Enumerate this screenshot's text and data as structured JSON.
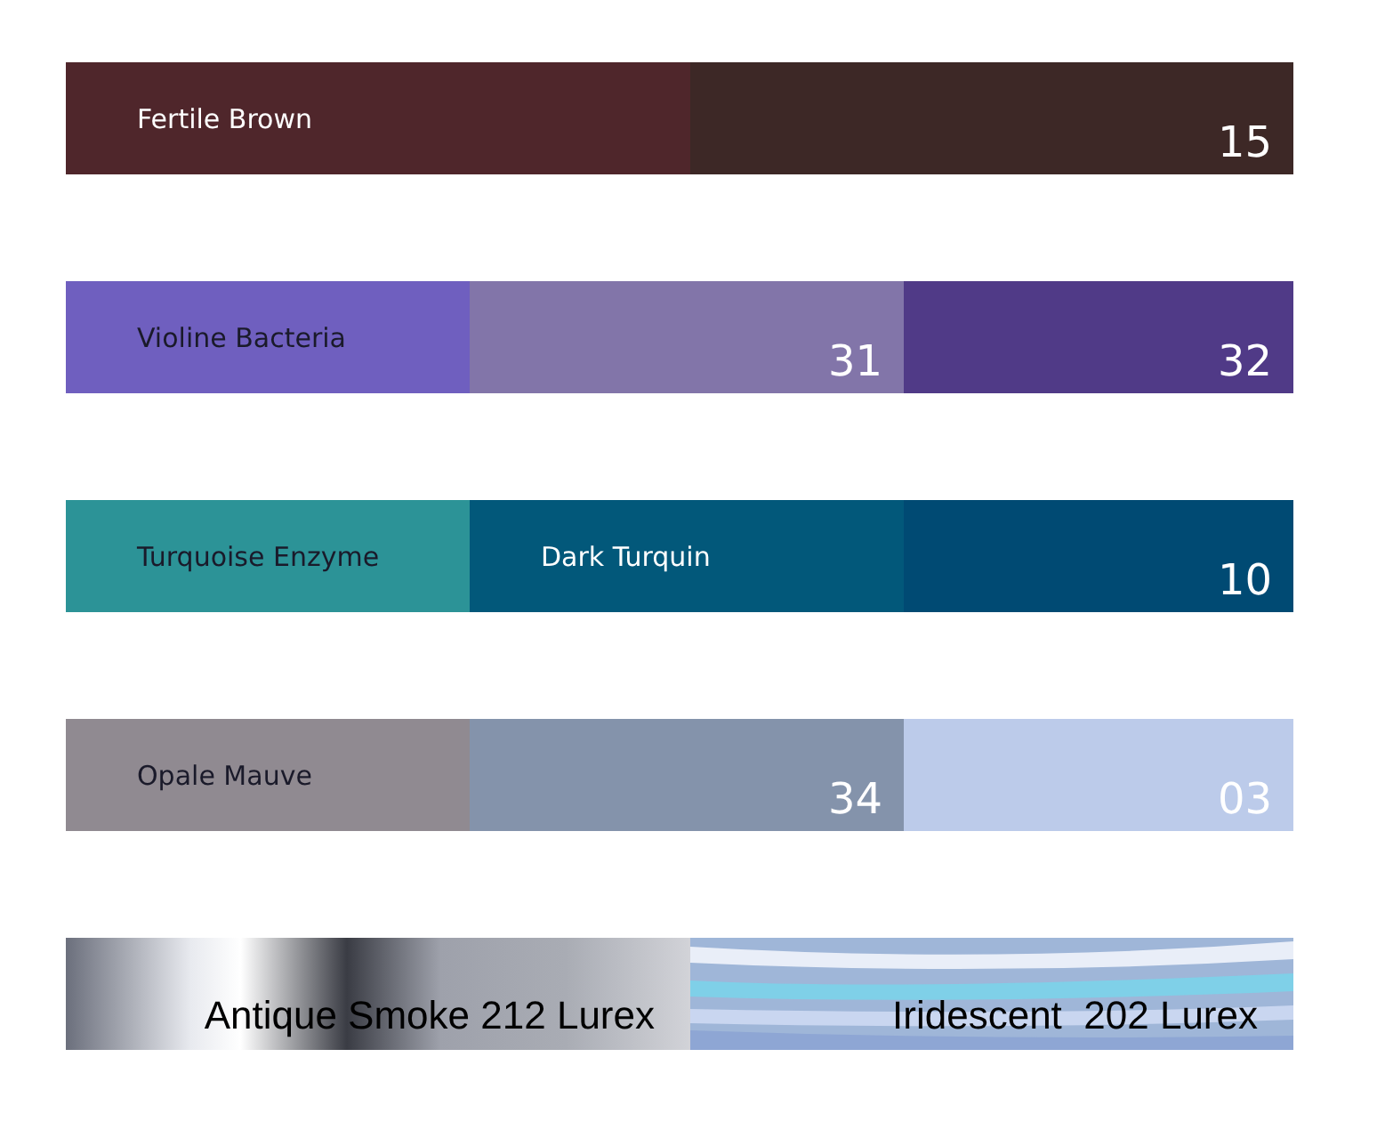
{
  "swatch_rows": [
    {
      "segments": [
        {
          "kind": "label",
          "text": "Fertile Brown",
          "color": "#4f262b"
        },
        {
          "kind": "number",
          "text": "15",
          "color": "#3d2826"
        }
      ]
    },
    {
      "segments": [
        {
          "kind": "label",
          "text": "Violine Bacteria",
          "color": "#6f5fbf"
        },
        {
          "kind": "number",
          "text": "31",
          "color": "#8275a9"
        },
        {
          "kind": "number",
          "text": "32",
          "color": "#503a87"
        }
      ]
    },
    {
      "segments": [
        {
          "kind": "label",
          "text": "Turquoise Enzyme",
          "color": "#2c9397"
        },
        {
          "kind": "label",
          "text": "Dark Turquin",
          "color": "#02587a"
        },
        {
          "kind": "number",
          "text": "10",
          "color": "#004a73"
        }
      ]
    },
    {
      "segments": [
        {
          "kind": "label",
          "text": "Opale Mauve",
          "color": "#908a91"
        },
        {
          "kind": "number",
          "text": "34",
          "color": "#8493ab"
        },
        {
          "kind": "number",
          "text": "03",
          "color": "#bccbea"
        }
      ]
    },
    {
      "segments": [
        {
          "kind": "metallic",
          "text": "Antique Smoke 212 Lurex"
        },
        {
          "kind": "iridescent",
          "text": "Iridescent  202 Lurex"
        }
      ]
    }
  ]
}
